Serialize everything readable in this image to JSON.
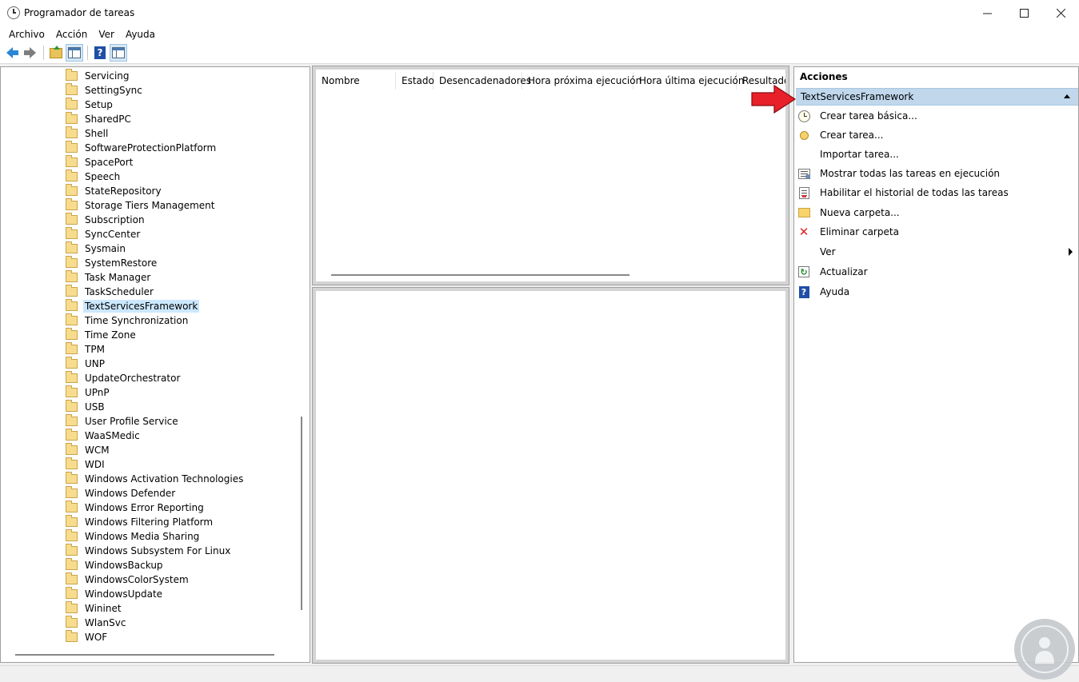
{
  "window": {
    "title": "Programador de tareas"
  },
  "menu": [
    "Archivo",
    "Acción",
    "Ver",
    "Ayuda"
  ],
  "tree": {
    "selected": "TextServicesFramework",
    "items": [
      "Servicing",
      "SettingSync",
      "Setup",
      "SharedPC",
      "Shell",
      "SoftwareProtectionPlatform",
      "SpacePort",
      "Speech",
      "StateRepository",
      "Storage Tiers Management",
      "Subscription",
      "SyncCenter",
      "Sysmain",
      "SystemRestore",
      "Task Manager",
      "TaskScheduler",
      "TextServicesFramework",
      "Time Synchronization",
      "Time Zone",
      "TPM",
      "UNP",
      "UpdateOrchestrator",
      "UPnP",
      "USB",
      "User Profile Service",
      "WaaSMedic",
      "WCM",
      "WDI",
      "Windows Activation Technologies",
      "Windows Defender",
      "Windows Error Reporting",
      "Windows Filtering Platform",
      "Windows Media Sharing",
      "Windows Subsystem For Linux",
      "WindowsBackup",
      "WindowsColorSystem",
      "WindowsUpdate",
      "Wininet",
      "WlanSvc",
      "WOF"
    ]
  },
  "task_table": {
    "columns": [
      "Nombre",
      "Estado",
      "Desencadenadores",
      "Hora próxima ejecución",
      "Hora última ejecución",
      "Resultado"
    ]
  },
  "actions": {
    "title": "Acciones",
    "section": "TextServicesFramework",
    "items": [
      {
        "label": "Crear tarea básica...",
        "icon": "basic-task-icon"
      },
      {
        "label": "Crear tarea...",
        "icon": "create-task-icon"
      },
      {
        "label": "Importar tarea...",
        "icon": ""
      },
      {
        "label": "Mostrar todas las tareas en ejecución",
        "icon": "running-tasks-icon"
      },
      {
        "label": "Habilitar el historial de todas las tareas",
        "icon": "history-icon"
      },
      {
        "label": "Nueva carpeta...",
        "icon": "folder-icon"
      },
      {
        "label": "Eliminar carpeta",
        "icon": "delete-icon"
      },
      {
        "label": "Ver",
        "icon": ""
      },
      {
        "label": "Actualizar",
        "icon": "refresh-icon"
      },
      {
        "label": "Ayuda",
        "icon": "help-icon"
      }
    ]
  },
  "colors": {
    "accent": "#2a86d6",
    "selection": "#cce8ff",
    "section_header": "#c0d7ec",
    "arrow": "#e8202a"
  }
}
